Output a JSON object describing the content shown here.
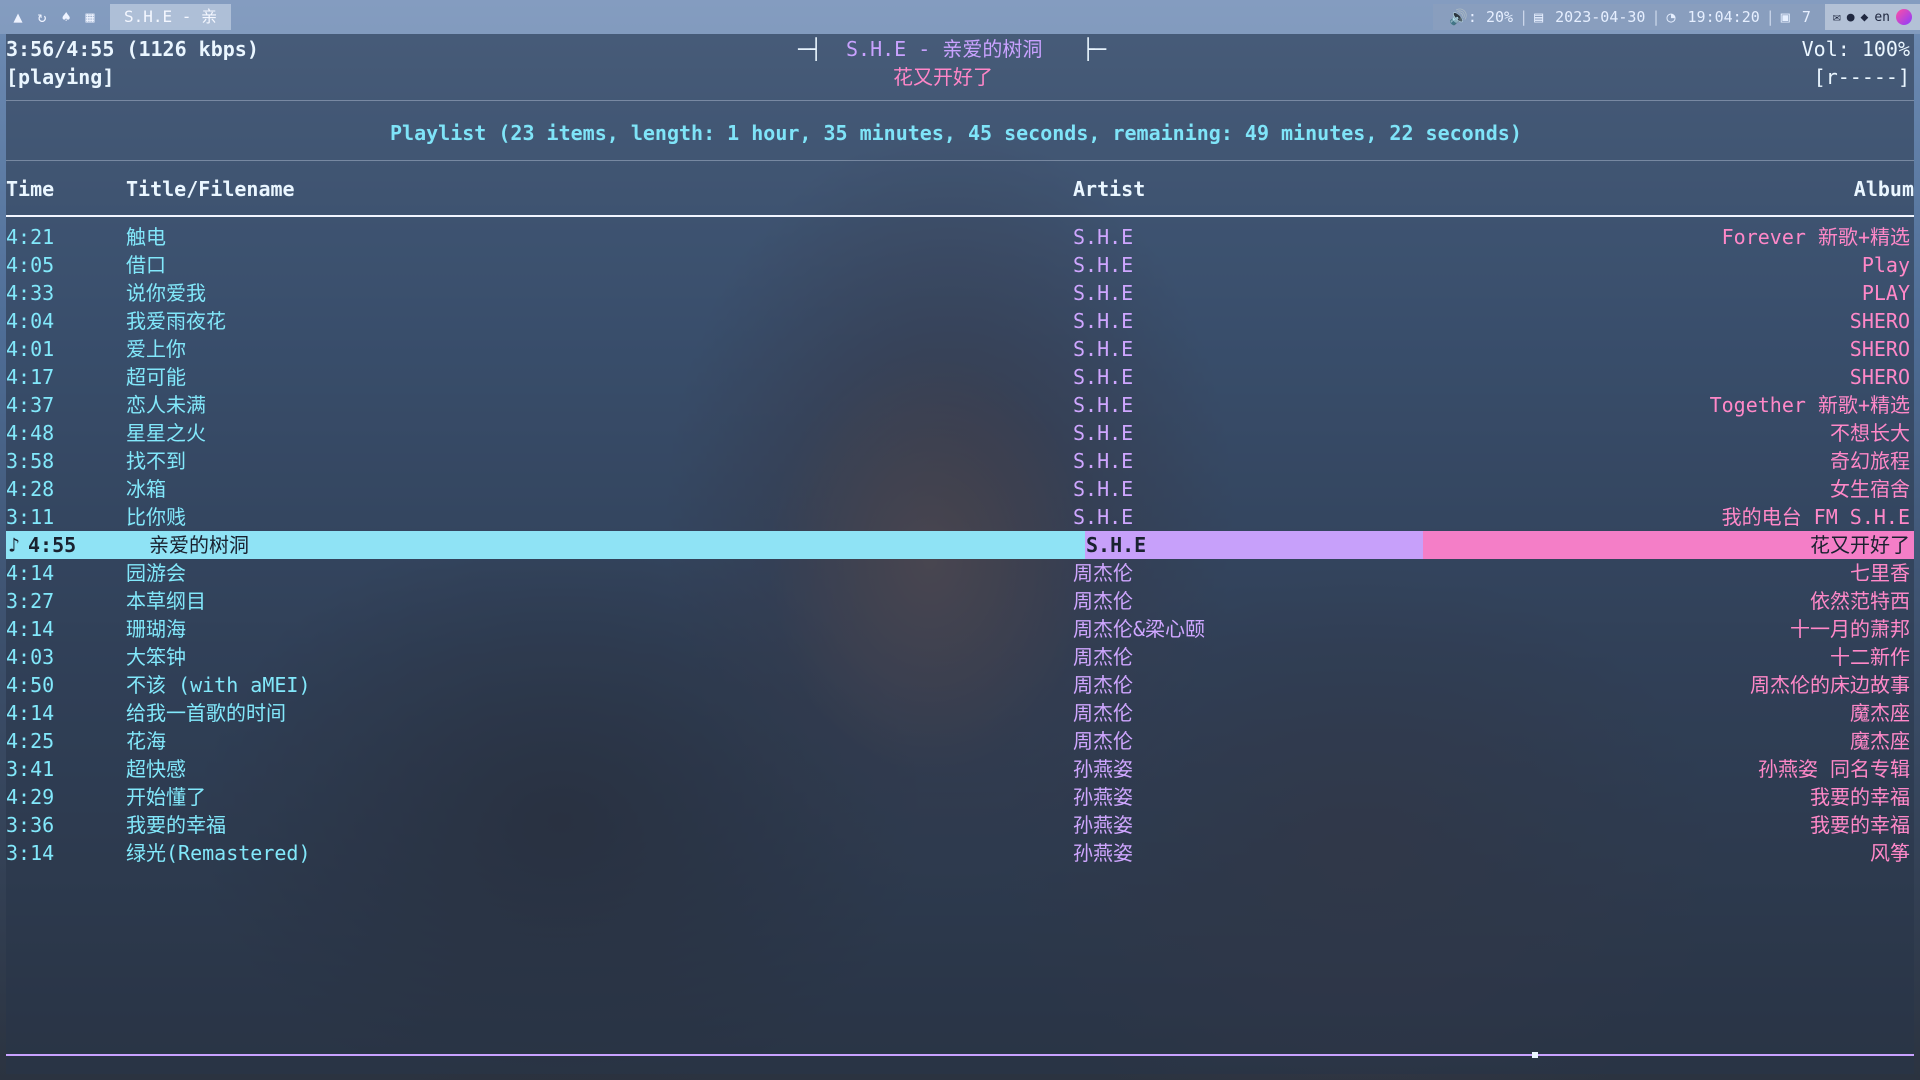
{
  "topbar": {
    "window_title": "S.H.E - 亲",
    "volume": "🔊: 20%",
    "date": "2023-04-30",
    "time": "19:04:20",
    "workspace": "7",
    "lang": "en"
  },
  "status": {
    "position": "3:56/4:55 (1126 kbps)",
    "state": "[playing]",
    "now_playing": "S.H.E - 亲爱的树洞",
    "now_album": "花又开好了",
    "volume": "Vol: 100%",
    "flags": "[r-----]"
  },
  "playlist": {
    "summary": "Playlist (23 items, length: 1 hour, 35 minutes, 45 seconds, remaining: 49 minutes, 22 seconds)",
    "headers": {
      "time": "Time",
      "title": "Title/Filename",
      "artist": "Artist",
      "album": "Album"
    },
    "rows": [
      {
        "time": "4:21",
        "title": "触电",
        "artist": "S.H.E",
        "album": "Forever 新歌+精选"
      },
      {
        "time": "4:05",
        "title": "借口",
        "artist": "S.H.E",
        "album": "Play"
      },
      {
        "time": "4:33",
        "title": "说你爱我",
        "artist": "S.H.E",
        "album": "PLAY"
      },
      {
        "time": "4:04",
        "title": "我爱雨夜花",
        "artist": "S.H.E",
        "album": "SHERO"
      },
      {
        "time": "4:01",
        "title": "爱上你",
        "artist": "S.H.E",
        "album": "SHERO"
      },
      {
        "time": "4:17",
        "title": "超可能",
        "artist": "S.H.E",
        "album": "SHERO"
      },
      {
        "time": "4:37",
        "title": "恋人未满",
        "artist": "S.H.E",
        "album": "Together 新歌+精选"
      },
      {
        "time": "4:48",
        "title": "星星之火",
        "artist": "S.H.E",
        "album": "不想长大"
      },
      {
        "time": "3:58",
        "title": "找不到",
        "artist": "S.H.E",
        "album": "奇幻旅程"
      },
      {
        "time": "4:28",
        "title": "冰箱",
        "artist": "S.H.E",
        "album": "女生宿舍"
      },
      {
        "time": "3:11",
        "title": "比你贱",
        "artist": "S.H.E",
        "album": "我的电台 FM S.H.E"
      },
      {
        "time": "4:55",
        "title": "亲爱的树洞",
        "artist": "S.H.E",
        "album": "花又开好了",
        "current": true,
        "marker": "♪"
      },
      {
        "time": "4:14",
        "title": "园游会",
        "artist": "周杰伦",
        "album": "七里香"
      },
      {
        "time": "3:27",
        "title": "本草纲目",
        "artist": "周杰伦",
        "album": "依然范特西"
      },
      {
        "time": "4:14",
        "title": "珊瑚海",
        "artist": "周杰伦&梁心颐",
        "album": "十一月的萧邦"
      },
      {
        "time": "4:03",
        "title": "大笨钟",
        "artist": "周杰伦",
        "album": "十二新作"
      },
      {
        "time": "4:50",
        "title": "不该 (with aMEI)",
        "artist": "周杰伦",
        "album": "周杰伦的床边故事"
      },
      {
        "time": "4:14",
        "title": "给我一首歌的时间",
        "artist": "周杰伦",
        "album": "魔杰座"
      },
      {
        "time": "4:25",
        "title": "花海",
        "artist": "周杰伦",
        "album": "魔杰座"
      },
      {
        "time": "3:41",
        "title": "超快感",
        "artist": "孙燕姿",
        "album": "孙燕姿 同名专辑"
      },
      {
        "time": "4:29",
        "title": "开始懂了",
        "artist": "孙燕姿",
        "album": "我要的幸福"
      },
      {
        "time": "3:36",
        "title": "我要的幸福",
        "artist": "孙燕姿",
        "album": "我要的幸福"
      },
      {
        "time": "3:14",
        "title": "绿光(Remastered)",
        "artist": "孙燕姿",
        "album": "风筝"
      }
    ]
  },
  "colors": {
    "cyan": "#82e8fb",
    "purple": "#cfa6ff",
    "pink": "#ff88c8"
  },
  "progress": {
    "fraction": 0.8
  }
}
